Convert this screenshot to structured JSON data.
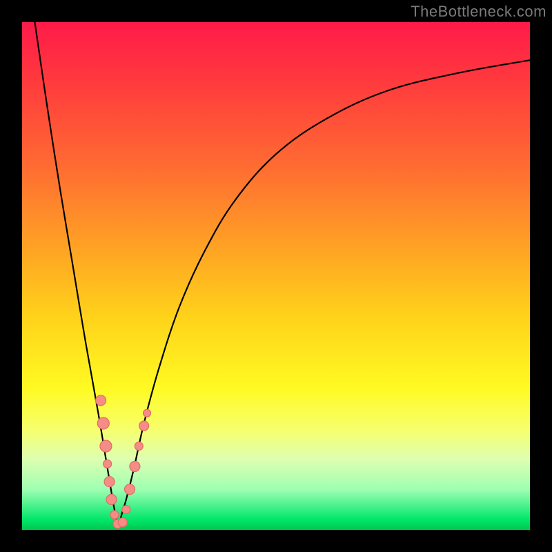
{
  "watermark": "TheBottleneck.com",
  "colors": {
    "frame": "#000000",
    "curve": "#000000",
    "marker_fill": "#f58c86",
    "marker_stroke": "#e36b63",
    "gradient_top": "#ff1a49",
    "gradient_bottom": "#00c74e"
  },
  "chart_data": {
    "type": "line",
    "title": "",
    "xlabel": "",
    "ylabel": "",
    "xlim": [
      0,
      100
    ],
    "ylim": [
      0,
      100
    ],
    "legend": null,
    "annotations": [],
    "series": [
      {
        "name": "left-branch",
        "x": [
          2.5,
          5,
          7.5,
          10,
          12.5,
          15,
          16.5,
          17.5,
          18,
          18.5,
          18.8
        ],
        "y": [
          100,
          83,
          67,
          52,
          37,
          23,
          14,
          8,
          5,
          2.5,
          1
        ]
      },
      {
        "name": "right-branch",
        "x": [
          19.2,
          19.6,
          20.5,
          22,
          24,
          27,
          31,
          36,
          42,
          50,
          60,
          72,
          86,
          100
        ],
        "y": [
          1,
          3,
          6,
          12,
          21,
          32,
          44,
          55,
          65,
          74,
          81,
          86.5,
          90,
          92.5
        ]
      }
    ],
    "markers": [
      {
        "x": 15.5,
        "y": 25.5,
        "r": 7.5
      },
      {
        "x": 16.0,
        "y": 21.0,
        "r": 8.5
      },
      {
        "x": 16.5,
        "y": 16.5,
        "r": 8.5
      },
      {
        "x": 16.8,
        "y": 13.0,
        "r": 6.0
      },
      {
        "x": 17.2,
        "y": 9.5,
        "r": 7.5
      },
      {
        "x": 17.6,
        "y": 6.0,
        "r": 7.5
      },
      {
        "x": 18.2,
        "y": 3.0,
        "r": 6.0
      },
      {
        "x": 18.8,
        "y": 1.2,
        "r": 6.5
      },
      {
        "x": 19.8,
        "y": 1.5,
        "r": 6.5
      },
      {
        "x": 20.5,
        "y": 4.0,
        "r": 6.0
      },
      {
        "x": 21.2,
        "y": 8.0,
        "r": 7.5
      },
      {
        "x": 22.2,
        "y": 12.5,
        "r": 7.5
      },
      {
        "x": 23.0,
        "y": 16.5,
        "r": 6.0
      },
      {
        "x": 24.0,
        "y": 20.5,
        "r": 7.0
      },
      {
        "x": 24.6,
        "y": 23.0,
        "r": 5.5
      }
    ]
  }
}
